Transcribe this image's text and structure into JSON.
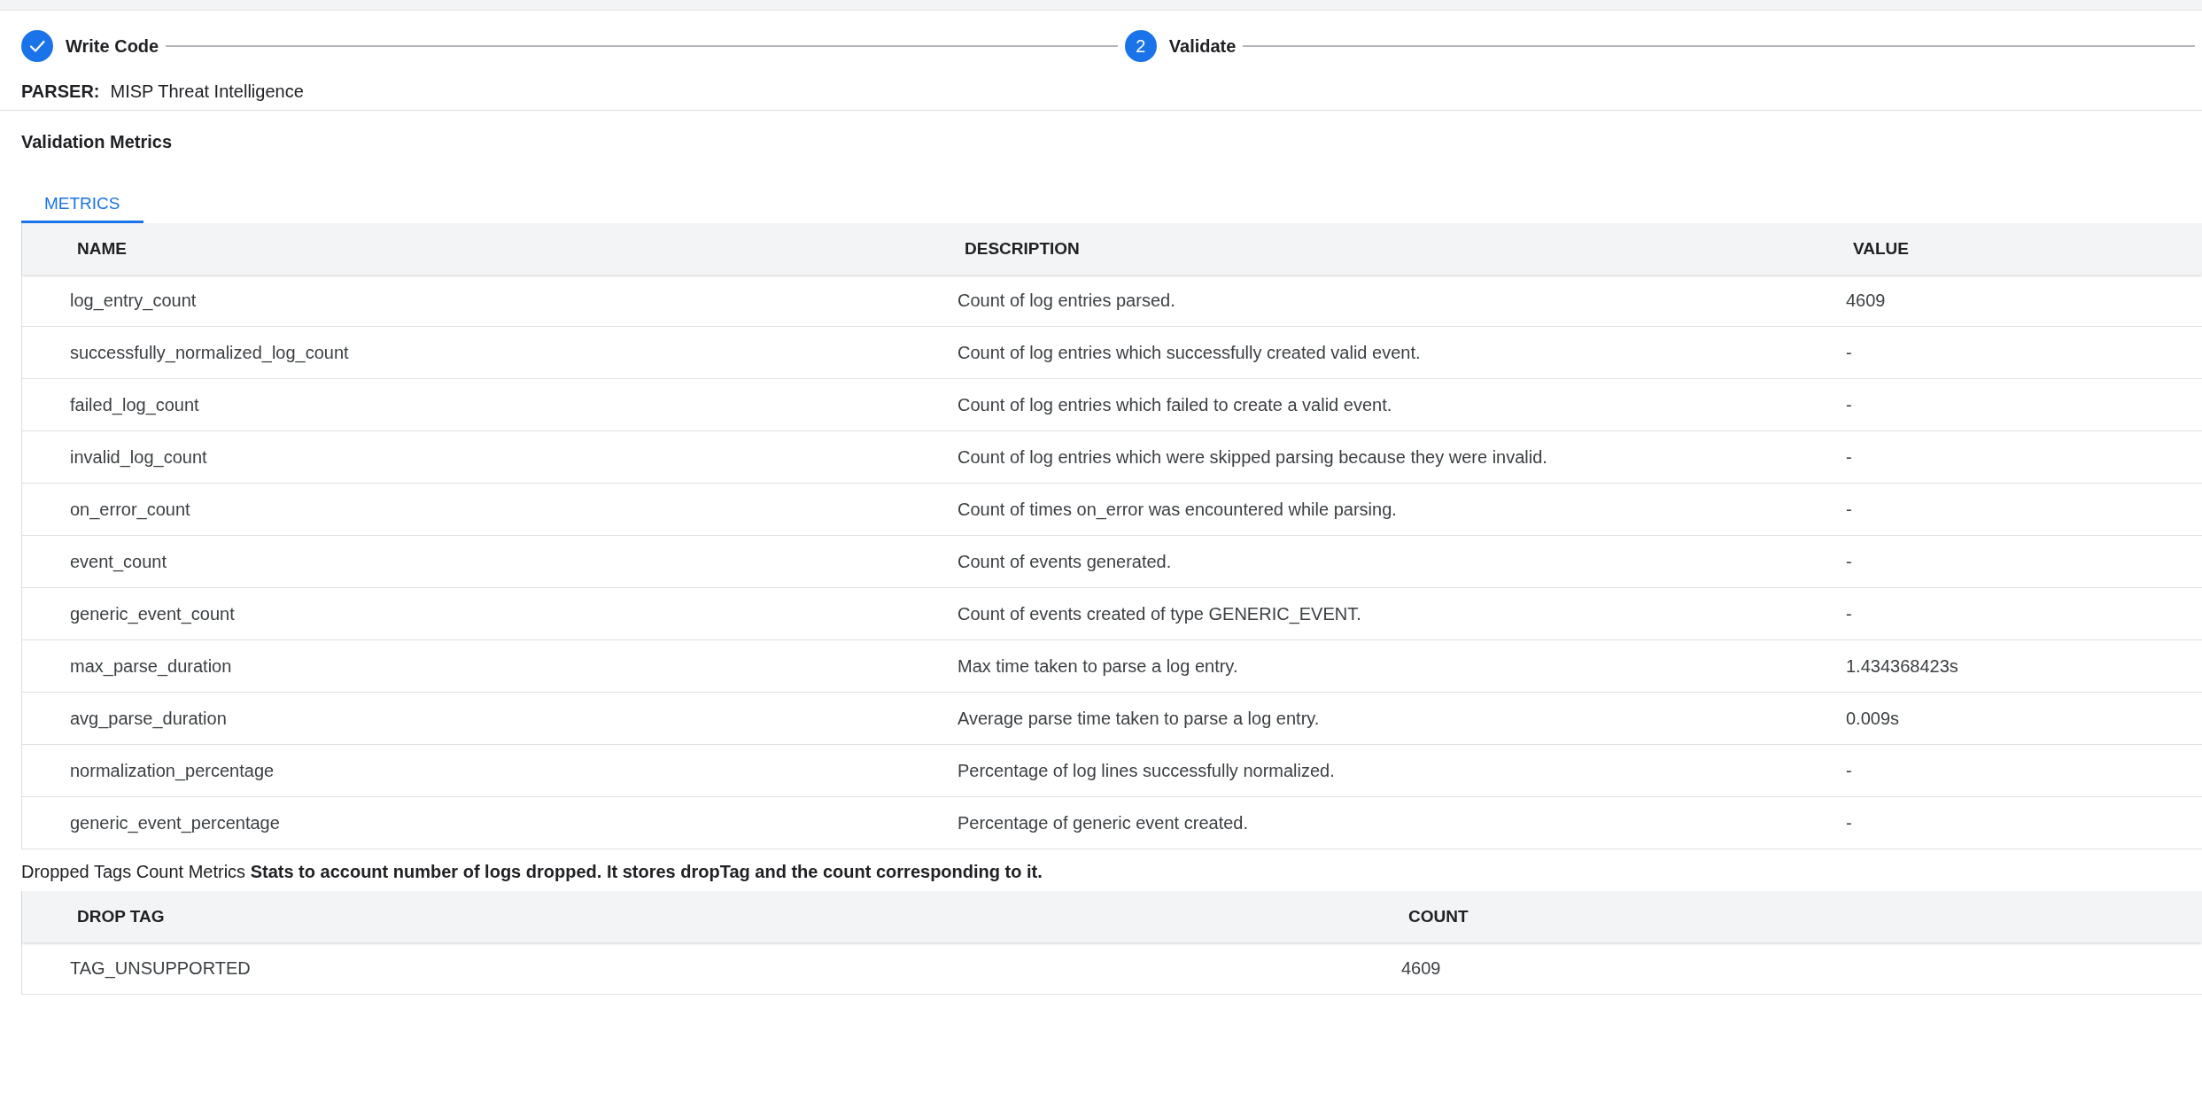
{
  "stepper": {
    "steps": [
      {
        "kind": "done",
        "label": "Write Code"
      },
      {
        "kind": "current",
        "number": "2",
        "label": "Validate"
      }
    ]
  },
  "parser": {
    "label": "PARSER:",
    "value": "MISP Threat Intelligence"
  },
  "section_title": "Validation Metrics",
  "tabs": [
    {
      "label": "METRICS",
      "selected": true
    }
  ],
  "metrics_table": {
    "columns": [
      "NAME",
      "DESCRIPTION",
      "VALUE"
    ],
    "rows": [
      [
        "log_entry_count",
        "Count of log entries parsed.",
        "4609"
      ],
      [
        "successfully_normalized_log_count",
        "Count of log entries which successfully created valid event.",
        "-"
      ],
      [
        "failed_log_count",
        "Count of log entries which failed to create a valid event.",
        "-"
      ],
      [
        "invalid_log_count",
        "Count of log entries which were skipped parsing because they were invalid.",
        "-"
      ],
      [
        "on_error_count",
        "Count of times on_error was encountered while parsing.",
        "-"
      ],
      [
        "event_count",
        "Count of events generated.",
        "-"
      ],
      [
        "generic_event_count",
        "Count of events created of type GENERIC_EVENT.",
        "-"
      ],
      [
        "max_parse_duration",
        "Max time taken to parse a log entry.",
        "1.434368423s"
      ],
      [
        "avg_parse_duration",
        "Average parse time taken to parse a log entry.",
        "0.009s"
      ],
      [
        "normalization_percentage",
        "Percentage of log lines successfully normalized.",
        "-"
      ],
      [
        "generic_event_percentage",
        "Percentage of generic event created.",
        "-"
      ]
    ]
  },
  "dropped_caption": "Dropped Tags Count Metrics **Stats to account number of logs dropped. It stores dropTag and the count corresponding to it.**",
  "dropped_table": {
    "columns": [
      "DROP TAG",
      "COUNT"
    ],
    "rows": [
      [
        "TAG_UNSUPPORTED",
        "4609"
      ]
    ]
  }
}
